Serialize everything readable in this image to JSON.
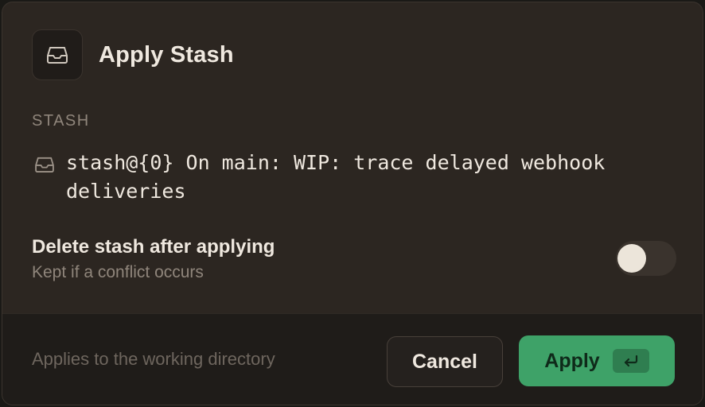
{
  "dialog": {
    "title": "Apply Stash",
    "header_icon": "inbox-icon"
  },
  "stash": {
    "section_label": "STASH",
    "icon": "inbox-icon",
    "entry": "stash@{0} On main: WIP: trace delayed webhook deliveries"
  },
  "option": {
    "title": "Delete stash after applying",
    "subtitle": "Kept if a conflict occurs",
    "toggle_on": false
  },
  "footer": {
    "hint": "Applies to the working directory",
    "cancel_label": "Cancel",
    "apply_label": "Apply",
    "apply_shortcut_icon": "enter-key-icon"
  },
  "colors": {
    "accent": "#3ea268",
    "background": "#2c2621",
    "footer_background": "#1f1c19"
  }
}
